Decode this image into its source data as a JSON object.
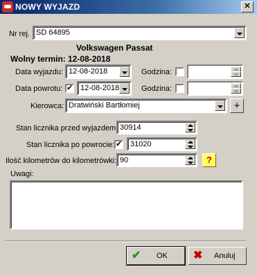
{
  "window": {
    "title": "NOWY WYJAZD"
  },
  "icons": {
    "app": "car-icon",
    "close": "close-icon",
    "ok": "check-icon",
    "cancel": "x-icon",
    "help": "question-icon"
  },
  "form": {
    "nr_rej": {
      "label": "Nr rej.",
      "value": "SD 64895"
    },
    "vehicle_name": "Volkswagen Passat",
    "free_date": {
      "label": "Wolny termin:",
      "value": "12-08-2018"
    },
    "departure": {
      "label": "Data wyjazdu:",
      "date": "12-08-2018",
      "time_label": "Godzina:",
      "time_checked": false,
      "time_value": ""
    },
    "return": {
      "label": "Data powrotu:",
      "checked": true,
      "date": "12-08-2018",
      "time_label": "Godzina:",
      "time_checked": false,
      "time_value": ""
    },
    "driver": {
      "label": "Kierowca:",
      "value": "Dratwiński Bartłomiej",
      "add_label": "+"
    },
    "odometer_start": {
      "label": "Stan licznika przed wyjazdem:",
      "value": "30914"
    },
    "odometer_end": {
      "label": "Stan licznika po powrocie:",
      "checked": true,
      "value": "31020"
    },
    "km_count": {
      "label": "Ilość kilometrów do kilometrówki:",
      "value": "90",
      "help_label": "?"
    },
    "notes": {
      "label": "Uwagi:",
      "value": ""
    }
  },
  "buttons": {
    "ok": "OK",
    "cancel": "Anuluj"
  }
}
